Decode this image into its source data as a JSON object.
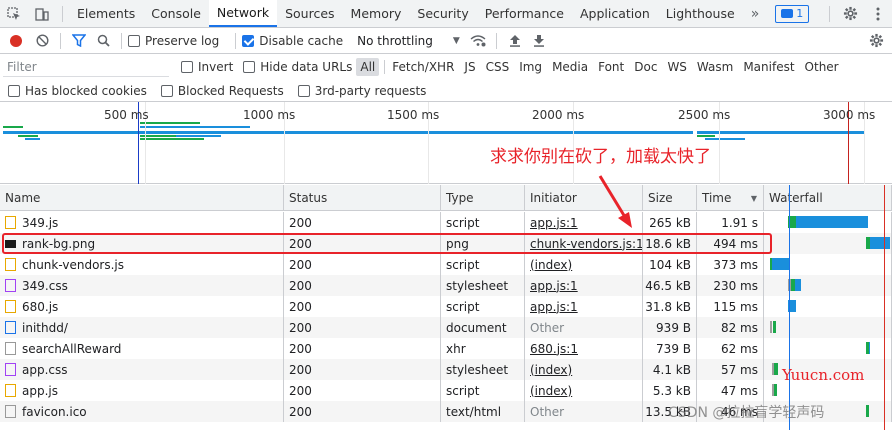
{
  "tabs": {
    "items": [
      "Elements",
      "Console",
      "Network",
      "Sources",
      "Memory",
      "Security",
      "Performance",
      "Application",
      "Lighthouse"
    ],
    "active": "Network",
    "more": "»",
    "issues_count": "1"
  },
  "toolbar": {
    "preserve_log": "Preserve log",
    "disable_cache": "Disable cache",
    "throttling": "No throttling"
  },
  "filters": {
    "placeholder": "Filter",
    "invert": "Invert",
    "hide_data_urls": "Hide data URLs",
    "types": [
      "All",
      "Fetch/XHR",
      "JS",
      "CSS",
      "Img",
      "Media",
      "Font",
      "Doc",
      "WS",
      "Wasm",
      "Manifest",
      "Other"
    ],
    "active_type": "All",
    "has_blocked_cookies": "Has blocked cookies",
    "blocked_requests": "Blocked Requests",
    "third_party": "3rd-party requests"
  },
  "overview": {
    "labels": [
      "500 ms",
      "1000 ms",
      "1500 ms",
      "2000 ms",
      "2500 ms",
      "3000 ms"
    ]
  },
  "table": {
    "columns": [
      "Name",
      "Status",
      "Type",
      "Initiator",
      "Size",
      "Time",
      "Waterfall"
    ],
    "rows": [
      {
        "name": "349.js",
        "status": "200",
        "type": "script",
        "initiator": "app.js:1",
        "size": "265 kB",
        "time": "1.91 s",
        "icon": "js"
      },
      {
        "name": "rank-bg.png",
        "status": "200",
        "type": "png",
        "initiator": "chunk-vendors.js:1",
        "size": "18.6 kB",
        "time": "494 ms",
        "icon": "img"
      },
      {
        "name": "chunk-vendors.js",
        "status": "200",
        "type": "script",
        "initiator": "(index)",
        "size": "104 kB",
        "time": "373 ms",
        "icon": "js"
      },
      {
        "name": "349.css",
        "status": "200",
        "type": "stylesheet",
        "initiator": "app.js:1",
        "size": "46.5 kB",
        "time": "230 ms",
        "icon": "css"
      },
      {
        "name": "680.js",
        "status": "200",
        "type": "script",
        "initiator": "app.js:1",
        "size": "31.8 kB",
        "time": "115 ms",
        "icon": "js"
      },
      {
        "name": "inithdd/",
        "status": "200",
        "type": "document",
        "initiator": "Other",
        "size": "939 B",
        "time": "82 ms",
        "icon": "doc"
      },
      {
        "name": "searchAllReward",
        "status": "200",
        "type": "xhr",
        "initiator": "680.js:1",
        "size": "739 B",
        "time": "62 ms",
        "icon": "plain"
      },
      {
        "name": "app.css",
        "status": "200",
        "type": "stylesheet",
        "initiator": "(index)",
        "size": "4.1 kB",
        "time": "57 ms",
        "icon": "css"
      },
      {
        "name": "app.js",
        "status": "200",
        "type": "script",
        "initiator": "(index)",
        "size": "5.3 kB",
        "time": "47 ms",
        "icon": "js"
      },
      {
        "name": "favicon.ico",
        "status": "200",
        "type": "text/html",
        "initiator": "Other",
        "size": "13.5 kB",
        "time": "46 ms",
        "icon": "plain"
      }
    ]
  },
  "annotation": "求求你别在砍了，加载太快了",
  "watermarks": {
    "site": "Yuucn.com",
    "csdn": "CSDN @拉拉盲学轻声码"
  },
  "colors": {
    "accent": "#1a73e8",
    "record": "#d93025",
    "highlight": "#e8232a",
    "bar_blue": "#1a8fdc",
    "bar_green": "#19a84a"
  }
}
